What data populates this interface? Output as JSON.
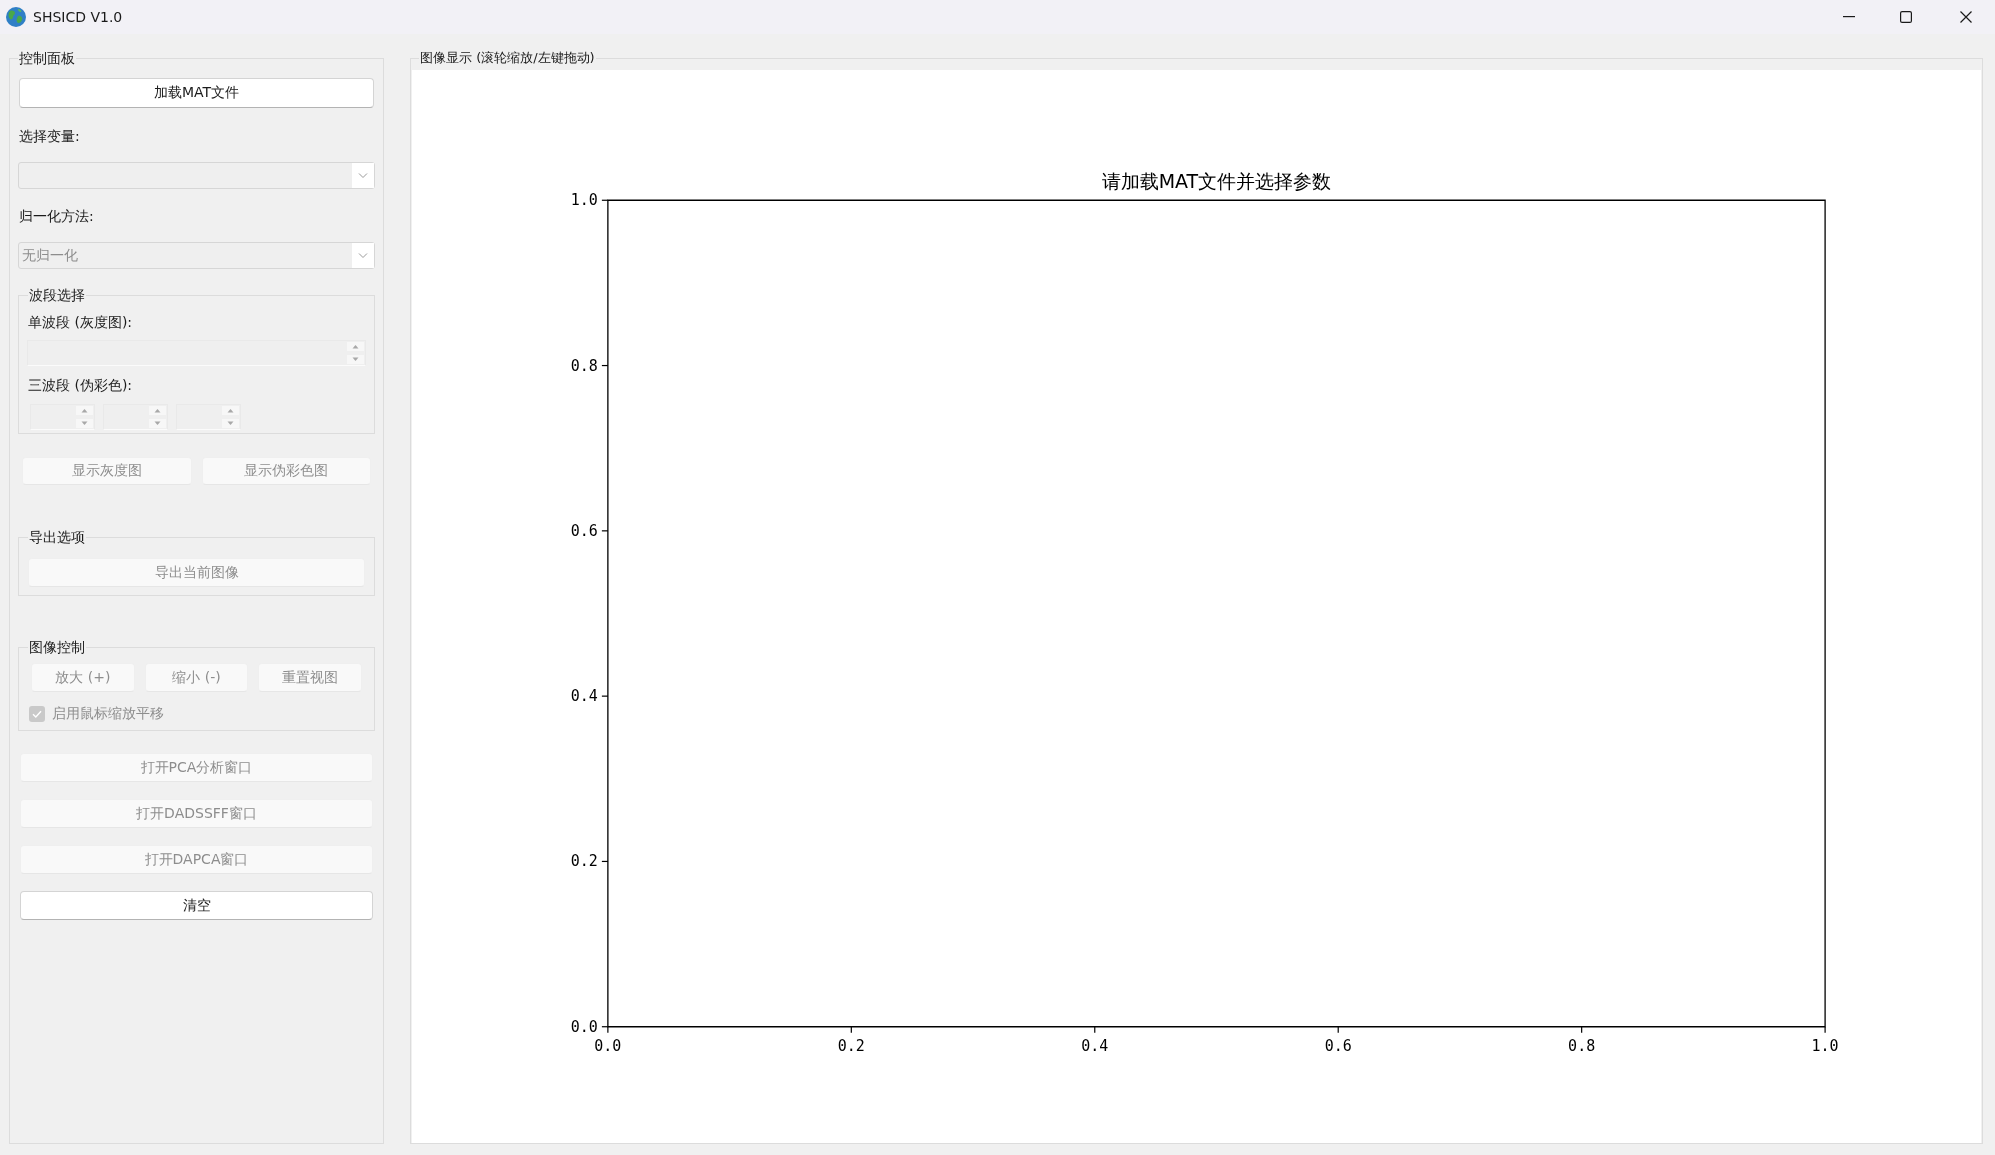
{
  "window": {
    "title": "SHSICD V1.0"
  },
  "control_panel": {
    "title": "控制面板",
    "load_button": {
      "label": "加载MAT文件",
      "disabled": false
    },
    "variable_label": "选择变量:",
    "variable_combo": {
      "disabled": true
    },
    "normalization_label": "归一化方法:",
    "normalization_combo": {
      "value": "无归一化",
      "disabled": true
    },
    "band_group": {
      "title": "波段选择",
      "single_label": "单波段 (灰度图):",
      "single_spinbox": {
        "disabled": true
      },
      "triple_label": "三波段 (伪彩色):",
      "triple_spinboxes": [
        {
          "disabled": true
        },
        {
          "disabled": true
        },
        {
          "disabled": true
        }
      ]
    },
    "display_buttons": [
      {
        "label": "显示灰度图",
        "disabled": true
      },
      {
        "label": "显示伪彩色图",
        "disabled": true
      }
    ],
    "export_group": {
      "title": "导出选项",
      "buttons": [
        {
          "label": "导出当前图像",
          "disabled": true
        }
      ]
    },
    "image_control_group": {
      "title": "图像控制",
      "buttons": [
        {
          "label": "放大 (+)",
          "disabled": true
        },
        {
          "label": "缩小 (-)",
          "disabled": true
        },
        {
          "label": "重置视图",
          "disabled": true
        }
      ],
      "checkbox": {
        "label": "启用鼠标缩放平移",
        "checked": true,
        "disabled": true
      }
    },
    "window_buttons": [
      {
        "label": "打开PCA分析窗口",
        "disabled": true
      },
      {
        "label": "打开DADSSFF窗口",
        "disabled": true
      },
      {
        "label": "打开DAPCA窗口",
        "disabled": true
      }
    ],
    "clear_button": {
      "label": "清空",
      "disabled": false
    }
  },
  "image_display": {
    "title": "图像显示 (滚轮缩放/左键拖动)",
    "chart_data": {
      "type": "line",
      "title": "请加载MAT文件并选择参数",
      "xlim": [
        0,
        1
      ],
      "ylim": [
        0,
        1
      ],
      "xticks": [
        {
          "value": 0,
          "label": "0.0"
        },
        {
          "value": 0.2,
          "label": "0.2"
        },
        {
          "value": 0.4,
          "label": "0.4"
        },
        {
          "value": 0.6,
          "label": "0.6"
        },
        {
          "value": 0.8,
          "label": "0.8"
        },
        {
          "value": 1,
          "label": "1.0"
        }
      ],
      "yticks": [
        {
          "value": 0,
          "label": "0.0"
        },
        {
          "value": 0.2,
          "label": "0.2"
        },
        {
          "value": 0.4,
          "label": "0.4"
        },
        {
          "value": 0.6,
          "label": "0.6"
        },
        {
          "value": 0.8,
          "label": "0.8"
        },
        {
          "value": 1,
          "label": "1.0"
        }
      ]
    }
  }
}
